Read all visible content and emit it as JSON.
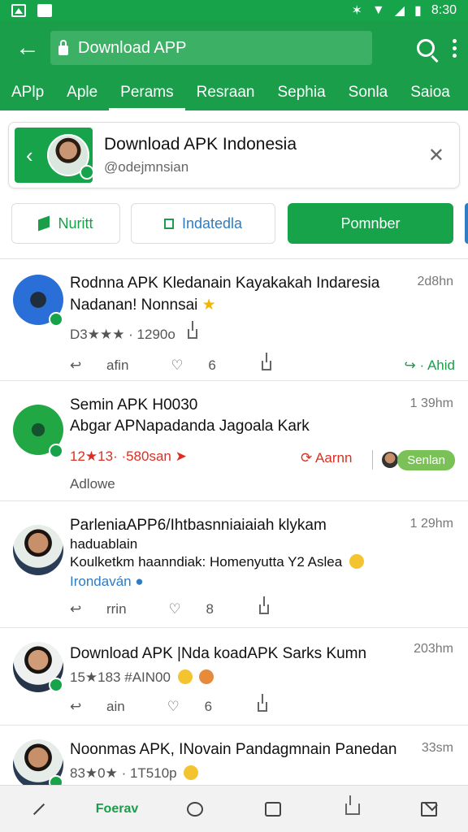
{
  "status_bar": {
    "time": "8:30"
  },
  "app_bar": {
    "url": "Download APP"
  },
  "tabs": [
    "APlp",
    "Aple",
    "Perams",
    "Resraan",
    "Sephia",
    "Sonla",
    "Saioa"
  ],
  "profile_card": {
    "title": "Download APK Indonesia",
    "handle": "@odejmnsian"
  },
  "action_buttons": {
    "btn1": "Nuritt",
    "btn2": "Indatedla",
    "btn3": "Pomnber"
  },
  "posts": [
    {
      "title": "Rodnna APK Kledanain Kayakakah Indaresia",
      "line2": "Nadanan! Nonnsai",
      "time": "2d8hn",
      "meta": "D3★★★ · 1290o",
      "action1": "afin",
      "action2": "6",
      "reply": "Ahid"
    },
    {
      "title": "Semin APK H0030",
      "line2": "Abgar APNapadanda Jagoala Kark",
      "time": "1 39hm",
      "meta": "12★13· ·580san",
      "red_action": "Aarnn",
      "chip": "Senlan",
      "footer": "Adlowe"
    },
    {
      "title": "ParleniaAPP6/Ihtbasnniaiaiah klykam",
      "line2": "haduablain",
      "line3": "Koulketkm haanndiak: Homenyutta Y2 Aslea",
      "link": "Irondaván",
      "time": "1 29hm",
      "action1": "rrin",
      "action2": "8"
    },
    {
      "title": "Download APK |Nda koadAPK Sarks Kumn",
      "meta": "15★183 #AIN00",
      "time": "203hm",
      "action1": "ain",
      "action2": "6"
    },
    {
      "title": "Noonmas APK, INovain Pandagmnain Panedan",
      "meta": "83★0★ · 1T510p",
      "time": "33sm"
    }
  ],
  "bottom_bar": {
    "home_label": "Foerav"
  },
  "colors": {
    "primary": "#16a34a",
    "link": "#2d7cc4",
    "alert": "#d93025"
  }
}
